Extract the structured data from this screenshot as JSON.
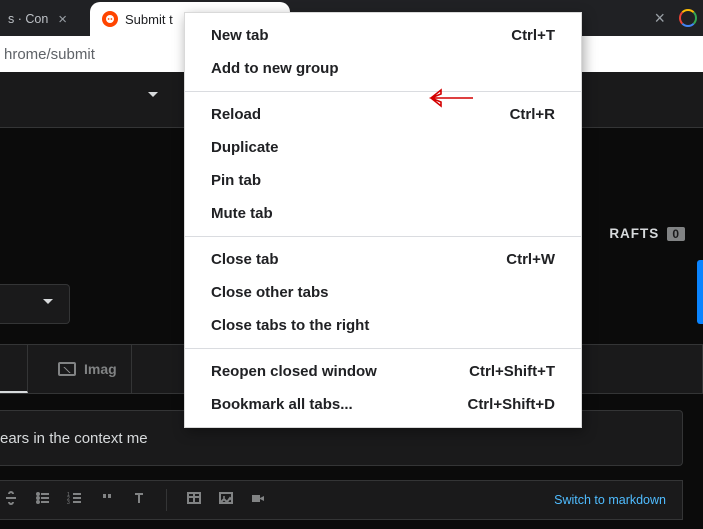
{
  "tabs": {
    "inactive1": {
      "title": "s · Con"
    },
    "active": {
      "title": "Submit t"
    }
  },
  "address_bar": {
    "url_fragment": "hrome/submit"
  },
  "reddit": {
    "drafts_label": "RAFTS",
    "drafts_count": "0",
    "image_tab_label": "Imag",
    "title_placeholder": "ears in the context me",
    "switch_markdown": "Switch to markdown"
  },
  "context_menu": {
    "groups": [
      [
        {
          "label": "New tab",
          "shortcut": "Ctrl+T"
        },
        {
          "label": "Add to new group",
          "shortcut": ""
        }
      ],
      [
        {
          "label": "Reload",
          "shortcut": "Ctrl+R"
        },
        {
          "label": "Duplicate",
          "shortcut": ""
        },
        {
          "label": "Pin tab",
          "shortcut": ""
        },
        {
          "label": "Mute tab",
          "shortcut": ""
        }
      ],
      [
        {
          "label": "Close tab",
          "shortcut": "Ctrl+W"
        },
        {
          "label": "Close other tabs",
          "shortcut": ""
        },
        {
          "label": "Close tabs to the right",
          "shortcut": ""
        }
      ],
      [
        {
          "label": "Reopen closed window",
          "shortcut": "Ctrl+Shift+T"
        },
        {
          "label": "Bookmark all tabs...",
          "shortcut": "Ctrl+Shift+D"
        }
      ]
    ]
  }
}
